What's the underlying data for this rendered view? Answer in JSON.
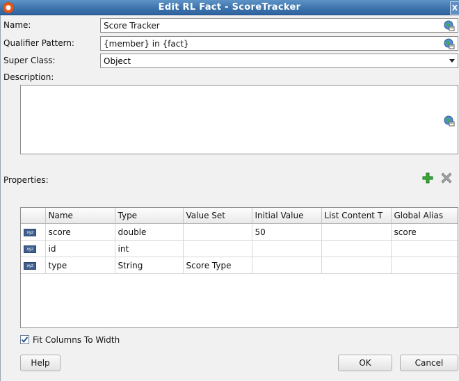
{
  "window": {
    "title": "Edit RL Fact - ScoreTracker",
    "close_glyph": "X"
  },
  "form": {
    "name_label": "Name:",
    "name_value": "Score Tracker",
    "qualifier_label": "Qualifier Pattern:",
    "qualifier_value": "{member} in {fact}",
    "superclass_label": "Super Class:",
    "superclass_value": "Object",
    "description_label": "Description:",
    "description_value": ""
  },
  "properties": {
    "label": "Properties:",
    "columns": [
      "",
      "Name",
      "Type",
      "Value Set",
      "Initial Value",
      "List Content T",
      "Global Alias"
    ],
    "rows": [
      {
        "icon": "xyz",
        "name": "score",
        "type": "double",
        "value_set": "",
        "initial_value": "50",
        "list_content": "",
        "global_alias": "score"
      },
      {
        "icon": "xyz",
        "name": "id",
        "type": "int",
        "value_set": "",
        "initial_value": "",
        "list_content": "",
        "global_alias": ""
      },
      {
        "icon": "xyz",
        "name": "type",
        "type": "String",
        "value_set": "Score Type",
        "initial_value": "",
        "list_content": "",
        "global_alias": ""
      }
    ]
  },
  "fit_columns": {
    "label": "Fit Columns To Width",
    "checked": true
  },
  "buttons": {
    "help": "Help",
    "ok": "OK",
    "cancel": "Cancel"
  },
  "colors": {
    "titlebar": "#3a70a9",
    "add_icon": "#3aa53a",
    "delete_icon": "#9a9a9a",
    "dialog_bg": "#f1f1f1"
  }
}
